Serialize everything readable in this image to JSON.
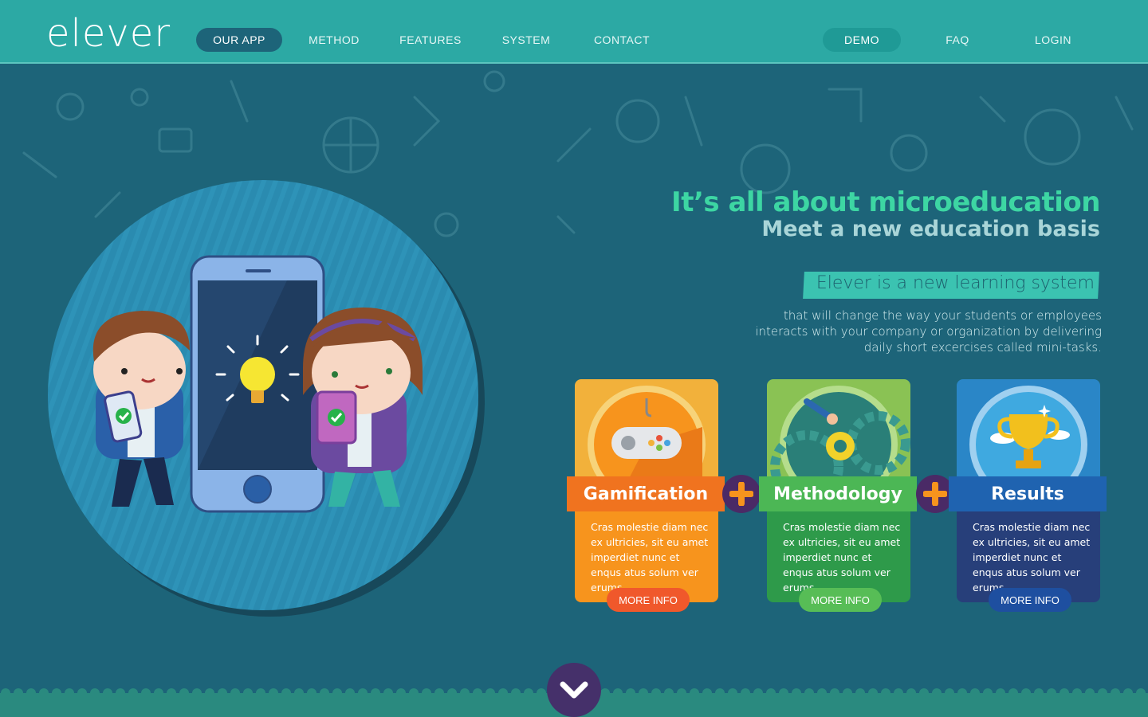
{
  "brand": {
    "logo_text": "elever"
  },
  "nav": {
    "items": [
      {
        "label": "OUR APP",
        "active": true
      },
      {
        "label": "METHOD"
      },
      {
        "label": "FEATURES"
      },
      {
        "label": "SYSTEM"
      },
      {
        "label": "CONTACT"
      }
    ],
    "right": [
      {
        "label": "DEMO",
        "highlight": true
      },
      {
        "label": "FAQ"
      },
      {
        "label": "LOGIN"
      }
    ]
  },
  "hero": {
    "headline": "It’s all about microeducation",
    "subheadline": "Meet a new education basis",
    "tagline": "Elever is a new learning system",
    "description_lines": [
      "that will change the way your students or employees",
      "interacts with your company or organization by delivering",
      "daily short excercises called mini-tasks."
    ]
  },
  "cards": [
    {
      "title": "Gamification",
      "body": "Cras molestie diam nec ex ultricies, sit eu amet imperdiet nunc et enqus atus solum ver erums.",
      "button": "MORE INFO",
      "icon": "gamepad-icon",
      "colors": {
        "top": "#f2b13b",
        "bottom": "#f7941d",
        "ribbon": "#f0731f",
        "button": "#f0582b"
      }
    },
    {
      "title": "Methodology",
      "body": "Cras molestie diam nec ex ultricies, sit eu amet imperdiet nunc et enqus atus solum ver erums.",
      "button": "MORE INFO",
      "icon": "gears-icon",
      "colors": {
        "top": "#8ac254",
        "bottom": "#2e9a4a",
        "ribbon": "#4cb755",
        "button": "#57bd56"
      }
    },
    {
      "title": "Results",
      "body": "Cras molestie diam nec ex ultricies, sit eu amet imperdiet nunc et enqus atus solum ver erums.",
      "button": "MORE INFO",
      "icon": "trophy-icon",
      "colors": {
        "top": "#2a86c7",
        "bottom": "#273f7a",
        "ribbon": "#1f63b0",
        "button": "#1e4fa0"
      }
    }
  ],
  "colors": {
    "nav_bg": "#2ca9a4",
    "hero_bg": "#1d6479",
    "headline": "#3dd6a3",
    "tagline_bg": "#3bc3b1",
    "plus_bg": "#4a2a66",
    "plus_fg": "#f7941d",
    "scroll_bg": "#45306a"
  }
}
